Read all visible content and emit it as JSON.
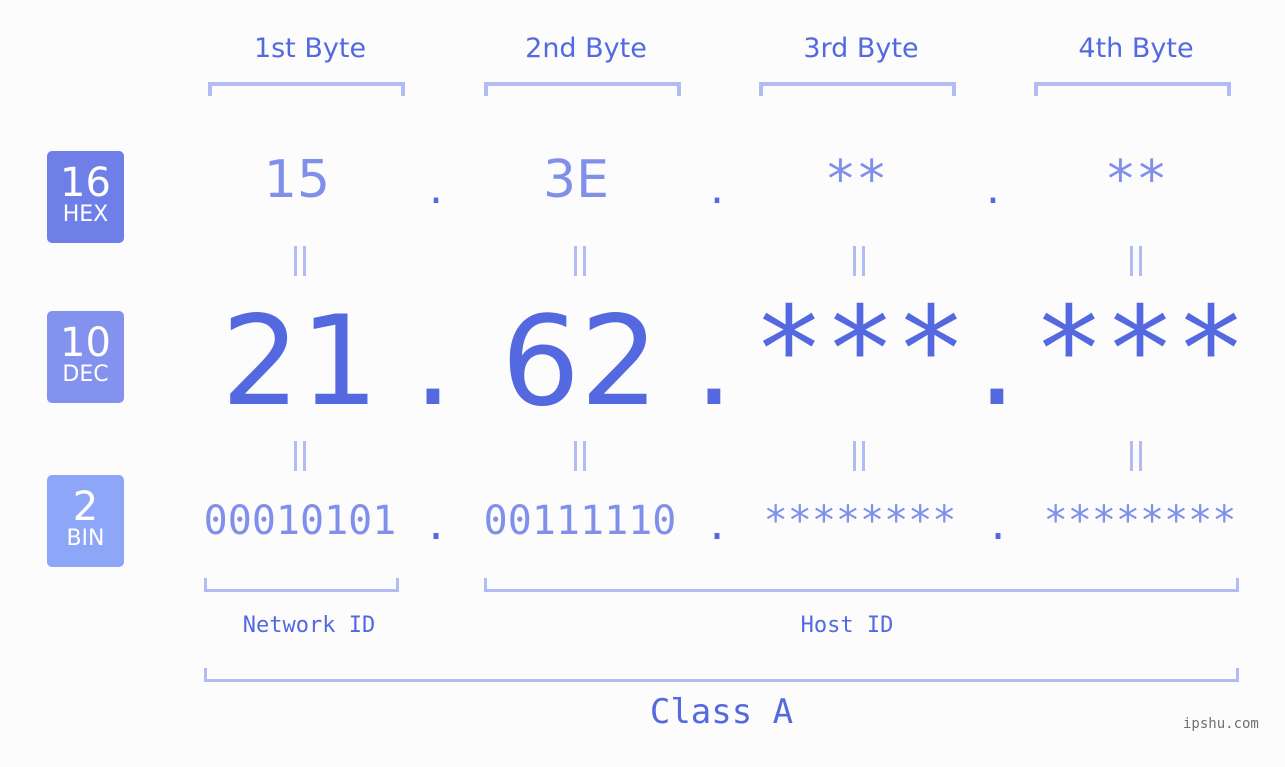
{
  "headers": [
    "1st Byte",
    "2nd Byte",
    "3rd Byte",
    "4th Byte"
  ],
  "badges": [
    {
      "num": "16",
      "label": "HEX",
      "color": "#6f7fe8"
    },
    {
      "num": "10",
      "label": "DEC",
      "color": "#8292ee"
    },
    {
      "num": "2",
      "label": "BIN",
      "color": "#8ea6f7"
    }
  ],
  "hex": [
    "15",
    "3E",
    "**",
    "**"
  ],
  "dec": [
    "21",
    "62",
    "***",
    "***"
  ],
  "bin": [
    "00010101",
    "00111110",
    "********",
    "********"
  ],
  "separator": ".",
  "labels": {
    "network_id": "Network ID",
    "host_id": "Host ID",
    "class": "Class A"
  },
  "watermark": "ipshu.com"
}
